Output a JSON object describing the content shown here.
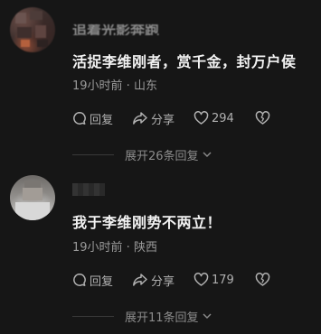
{
  "comments": [
    {
      "username": "追着光影奔跑",
      "text": "活捉李维刚者，赏千金，封万户侯",
      "time": "19小时前",
      "location": "山东",
      "reply_label": "回复",
      "share_label": "分享",
      "likes": "294",
      "expand_label": "展开26条回复"
    },
    {
      "username": "",
      "text": "我于李维刚势不两立！",
      "time": "19小时前",
      "location": "陕西",
      "reply_label": "回复",
      "share_label": "分享",
      "likes": "179",
      "expand_label": "展开11条回复"
    }
  ],
  "meta_separator": " · ",
  "icons": {
    "reply": "chat-bubble-icon",
    "share": "share-arrow-icon",
    "like": "heart-icon",
    "dislike": "broken-heart-icon",
    "expand": "chevron-down-icon"
  },
  "colors": {
    "background": "#161616",
    "text": "#f2f2f2",
    "muted": "#9a9a9a"
  }
}
